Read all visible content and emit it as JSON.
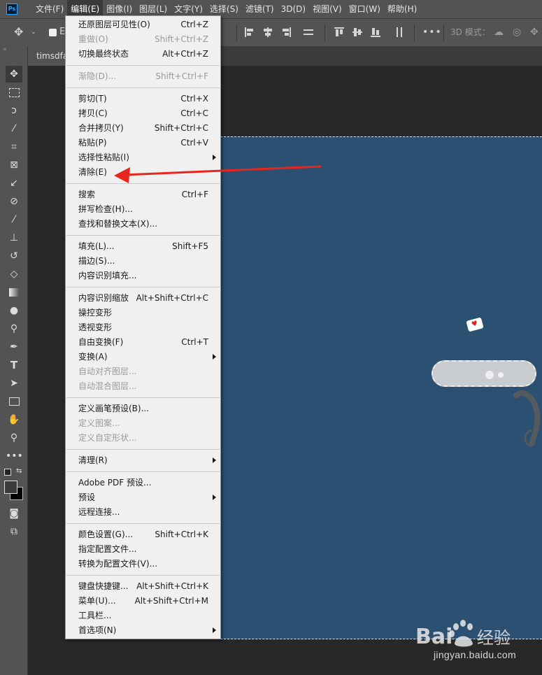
{
  "app": {
    "logo_text": "Ps"
  },
  "menubar": {
    "items": [
      "文件(F)",
      "编辑(E)",
      "图像(I)",
      "图层(L)",
      "文字(Y)",
      "选择(S)",
      "滤镜(T)",
      "3D(D)",
      "视图(V)",
      "窗口(W)",
      "帮助(H)"
    ],
    "active_index": 1
  },
  "options_bar": {
    "mode_3d_label": "3D 模式：",
    "partial_label": "E"
  },
  "document": {
    "tab_title": "timsdfa"
  },
  "edit_menu": {
    "groups": [
      [
        {
          "label": "还原图层可见性(O)",
          "shortcut": "Ctrl+Z",
          "disabled": false,
          "submenu": false
        },
        {
          "label": "重做(O)",
          "shortcut": "Shift+Ctrl+Z",
          "disabled": true,
          "submenu": false
        },
        {
          "label": "切换最终状态",
          "shortcut": "Alt+Ctrl+Z",
          "disabled": false,
          "submenu": false
        }
      ],
      [
        {
          "label": "渐隐(D)...",
          "shortcut": "Shift+Ctrl+F",
          "disabled": true,
          "submenu": false
        }
      ],
      [
        {
          "label": "剪切(T)",
          "shortcut": "Ctrl+X",
          "disabled": false,
          "submenu": false
        },
        {
          "label": "拷贝(C)",
          "shortcut": "Ctrl+C",
          "disabled": false,
          "submenu": false
        },
        {
          "label": "合并拷贝(Y)",
          "shortcut": "Shift+Ctrl+C",
          "disabled": false,
          "submenu": false
        },
        {
          "label": "粘贴(P)",
          "shortcut": "Ctrl+V",
          "disabled": false,
          "submenu": false
        },
        {
          "label": "选择性粘贴(I)",
          "shortcut": "",
          "disabled": false,
          "submenu": true
        },
        {
          "label": "清除(E)",
          "shortcut": "",
          "disabled": false,
          "submenu": false
        }
      ],
      [
        {
          "label": "搜索",
          "shortcut": "Ctrl+F",
          "disabled": false,
          "submenu": false
        },
        {
          "label": "拼写检查(H)...",
          "shortcut": "",
          "disabled": false,
          "submenu": false
        },
        {
          "label": "查找和替换文本(X)...",
          "shortcut": "",
          "disabled": false,
          "submenu": false
        }
      ],
      [
        {
          "label": "填充(L)...",
          "shortcut": "Shift+F5",
          "disabled": false,
          "submenu": false
        },
        {
          "label": "描边(S)...",
          "shortcut": "",
          "disabled": false,
          "submenu": false
        },
        {
          "label": "内容识别填充...",
          "shortcut": "",
          "disabled": false,
          "submenu": false
        }
      ],
      [
        {
          "label": "内容识别缩放",
          "shortcut": "Alt+Shift+Ctrl+C",
          "disabled": false,
          "submenu": false
        },
        {
          "label": "操控变形",
          "shortcut": "",
          "disabled": false,
          "submenu": false
        },
        {
          "label": "透视变形",
          "shortcut": "",
          "disabled": false,
          "submenu": false
        },
        {
          "label": "自由变换(F)",
          "shortcut": "Ctrl+T",
          "disabled": false,
          "submenu": false
        },
        {
          "label": "变换(A)",
          "shortcut": "",
          "disabled": false,
          "submenu": true
        },
        {
          "label": "自动对齐图层...",
          "shortcut": "",
          "disabled": true,
          "submenu": false
        },
        {
          "label": "自动混合图层...",
          "shortcut": "",
          "disabled": true,
          "submenu": false
        }
      ],
      [
        {
          "label": "定义画笔预设(B)...",
          "shortcut": "",
          "disabled": false,
          "submenu": false
        },
        {
          "label": "定义图案...",
          "shortcut": "",
          "disabled": true,
          "submenu": false
        },
        {
          "label": "定义自定形状...",
          "shortcut": "",
          "disabled": true,
          "submenu": false
        }
      ],
      [
        {
          "label": "清理(R)",
          "shortcut": "",
          "disabled": false,
          "submenu": true
        }
      ],
      [
        {
          "label": "Adobe PDF 预设...",
          "shortcut": "",
          "disabled": false,
          "submenu": false
        },
        {
          "label": "预设",
          "shortcut": "",
          "disabled": false,
          "submenu": true
        },
        {
          "label": "远程连接...",
          "shortcut": "",
          "disabled": false,
          "submenu": false
        }
      ],
      [
        {
          "label": "颜色设置(G)...",
          "shortcut": "Shift+Ctrl+K",
          "disabled": false,
          "submenu": false
        },
        {
          "label": "指定配置文件...",
          "shortcut": "",
          "disabled": false,
          "submenu": false
        },
        {
          "label": "转换为配置文件(V)...",
          "shortcut": "",
          "disabled": false,
          "submenu": false
        }
      ],
      [
        {
          "label": "键盘快捷键...",
          "shortcut": "Alt+Shift+Ctrl+K",
          "disabled": false,
          "submenu": false
        },
        {
          "label": "菜单(U)...",
          "shortcut": "Alt+Shift+Ctrl+M",
          "disabled": false,
          "submenu": false
        },
        {
          "label": "工具栏...",
          "shortcut": "",
          "disabled": false,
          "submenu": false
        },
        {
          "label": "首选项(N)",
          "shortcut": "",
          "disabled": false,
          "submenu": true
        }
      ]
    ]
  },
  "toolbar": {
    "tools": [
      "move-tool",
      "marquee-tool",
      "lasso-tool",
      "magic-wand-tool",
      "crop-tool",
      "frame-tool",
      "eyedropper-tool",
      "healing-brush-tool",
      "brush-tool",
      "clone-stamp-tool",
      "history-brush-tool",
      "eraser-tool",
      "gradient-tool",
      "blur-tool",
      "dodge-tool",
      "pen-tool",
      "type-tool",
      "path-selection-tool",
      "rectangle-tool",
      "hand-tool",
      "zoom-tool",
      "more-tools"
    ]
  },
  "watermark": {
    "brand_text": "Bai 经验",
    "url": "jingyan.baidu.com"
  },
  "annotation": {
    "arrow_color": "#e8261f",
    "points_to": "清除(E)"
  },
  "colors": {
    "menubar": "#535353",
    "canvas": "#2b5071",
    "menu_bg": "#f0f0f0"
  }
}
